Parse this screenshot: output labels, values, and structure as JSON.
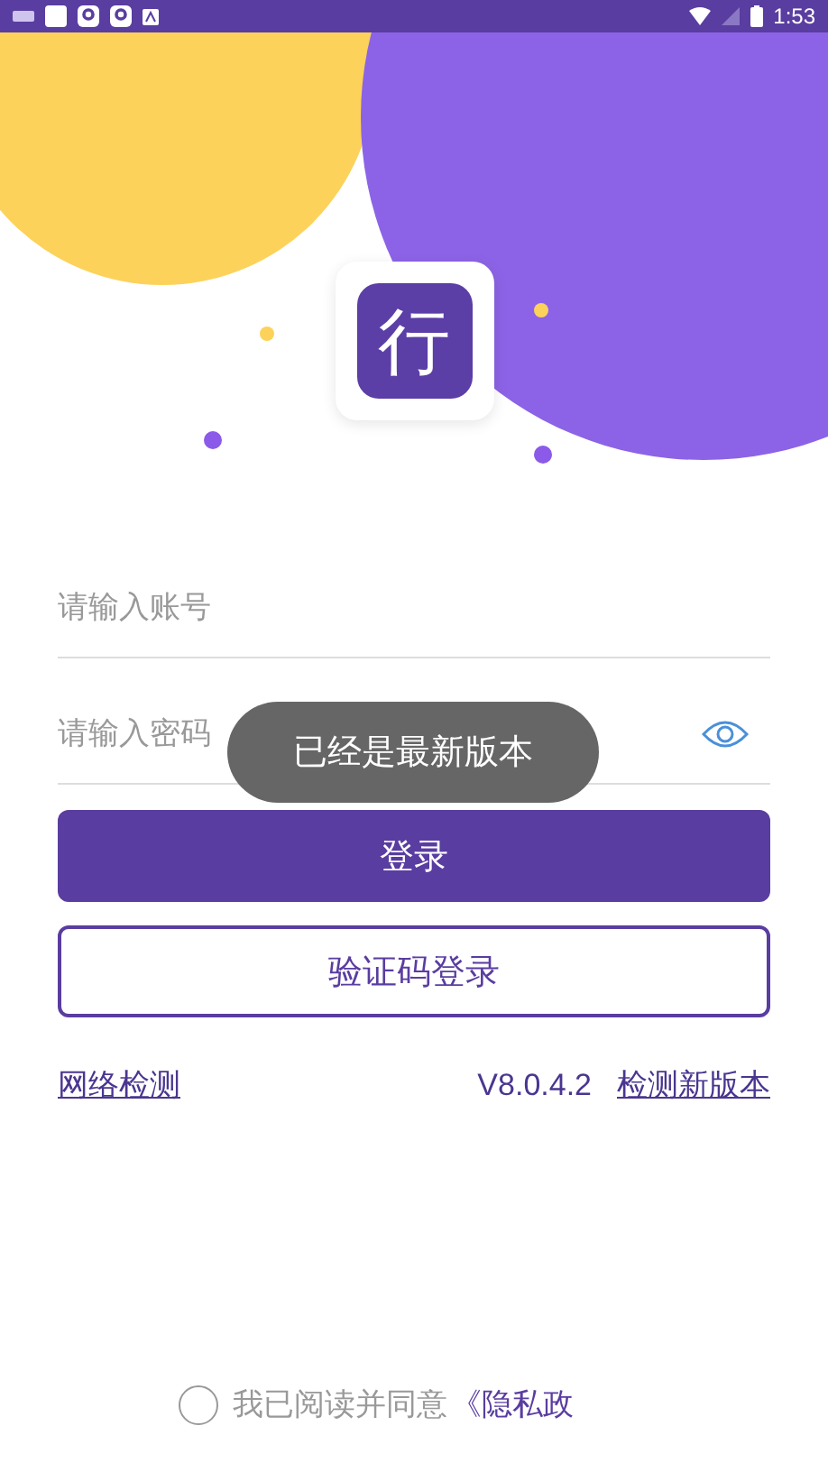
{
  "status_bar": {
    "time": "1:53"
  },
  "logo": {
    "glyph": "行"
  },
  "account_field": {
    "placeholder": "请输入账号"
  },
  "password_field": {
    "placeholder": "请输入密码",
    "password_visible": false
  },
  "login_button": "登录",
  "code_login_button": "验证码登录",
  "links": {
    "network_check": "网络检测",
    "version": "V8.0.4.2",
    "check_update": "检测新版本"
  },
  "toast": "已经是最新版本",
  "agreement": {
    "checked": false,
    "text": "我已阅读并同意",
    "link": "《隐私政"
  }
}
